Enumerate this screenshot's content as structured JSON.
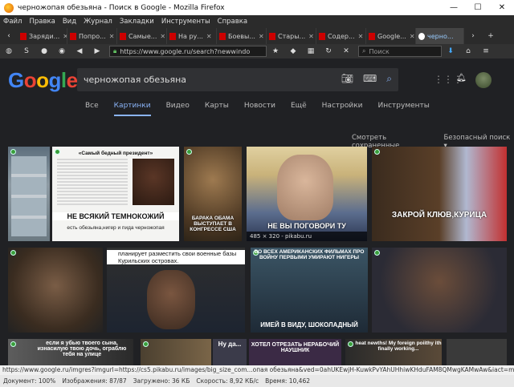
{
  "window": {
    "title": "черножопая обезьяна - Поиск в Google - Mozilla Firefox",
    "minimize": "—",
    "maximize": "☐",
    "close": "✕"
  },
  "menu": [
    "Файл",
    "Правка",
    "Вид",
    "Журнал",
    "Закладки",
    "Инструменты",
    "Справка"
  ],
  "tabs": [
    {
      "label": "Заряди..."
    },
    {
      "label": "Попро..."
    },
    {
      "label": "Самые..."
    },
    {
      "label": "На ру..."
    },
    {
      "label": "Боевы..."
    },
    {
      "label": "Стары..."
    },
    {
      "label": "Содер..."
    },
    {
      "label": "Google..."
    },
    {
      "label": "черно..."
    }
  ],
  "nav": {
    "url": "https://www.google.ru/search?newwindo",
    "search_placeholder": "Поиск"
  },
  "google": {
    "logo": "Google",
    "logo_colors": [
      "#4285f4",
      "#ea4335",
      "#fbbc05",
      "#4285f4",
      "#34a853",
      "#ea4335"
    ],
    "query": "черножопая обезьяна",
    "tabs": [
      "Все",
      "Картинки",
      "Видео",
      "Карты",
      "Новости",
      "Ещё",
      "Настройки",
      "Инструменты"
    ],
    "active_tab": "Картинки",
    "saved": "Смотреть сохраненные",
    "safe_search": "Безопасный поиск ▾"
  },
  "images": [
    {
      "caption": ""
    },
    {
      "top_caption": "«Самый бедный президент»",
      "caption": "НЕ ВСЯКИЙ ТЕМНОКОЖИЙ",
      "sub": "есть обезьяна,нигер и пида черножопая"
    },
    {
      "caption": "БАРАКА ОБАМА ВЫСТУПАЕТ В КОНГРЕССЕ США"
    },
    {
      "caption": "НЕ ВЫ ПОГОВОРИ ТУ",
      "dims": "485 × 320 - pikabu.ru"
    },
    {
      "caption": "ЗАКРОЙ КЛЮВ,КУРИЦА"
    },
    {
      "caption": ""
    },
    {
      "top_caption": "планирует разместить свои военные базы Курильских островах."
    },
    {
      "top_caption": "ВО ВСЕХ АМЕРИКАНСКИХ ФИЛЬМАХ ПРО ВОЙНУ ПЕРВЫМИ УМИРАЮТ НИГЕРЫ",
      "caption": "ИМЕЙ В ВИДУ, ШОКОЛАДНЫЙ"
    },
    {
      "caption": ""
    },
    {
      "caption": "если я убью твоего сына, изнасилую твою дочь, ограблю тебя на улице"
    },
    {
      "caption": ""
    },
    {
      "caption": "Ну да..."
    },
    {
      "caption": "ХОТЕЛ ОТРЕЗАТЬ НЕРАБОЧИЙ НАУШНИК"
    },
    {
      "caption": "heat newths! My foreign poiithy ith finally working..."
    }
  ],
  "status": {
    "link": "https://www.google.ru/imgres?imgurl=https://cs5.pikabu.ru/images/big_size_com...опая обезьяна&ved=0ahUKEwjH-KuwkPvYAhUHhiwKHduFAM8QMwgKAMwAw&iact=mrc&uact=8",
    "document": "Документ: 100%",
    "images": "Изображения: 87/87",
    "loaded": "Загружено: 36 КБ",
    "speed": "Скорость: 8,92 КБ/с",
    "time": "Время: 10,462"
  }
}
